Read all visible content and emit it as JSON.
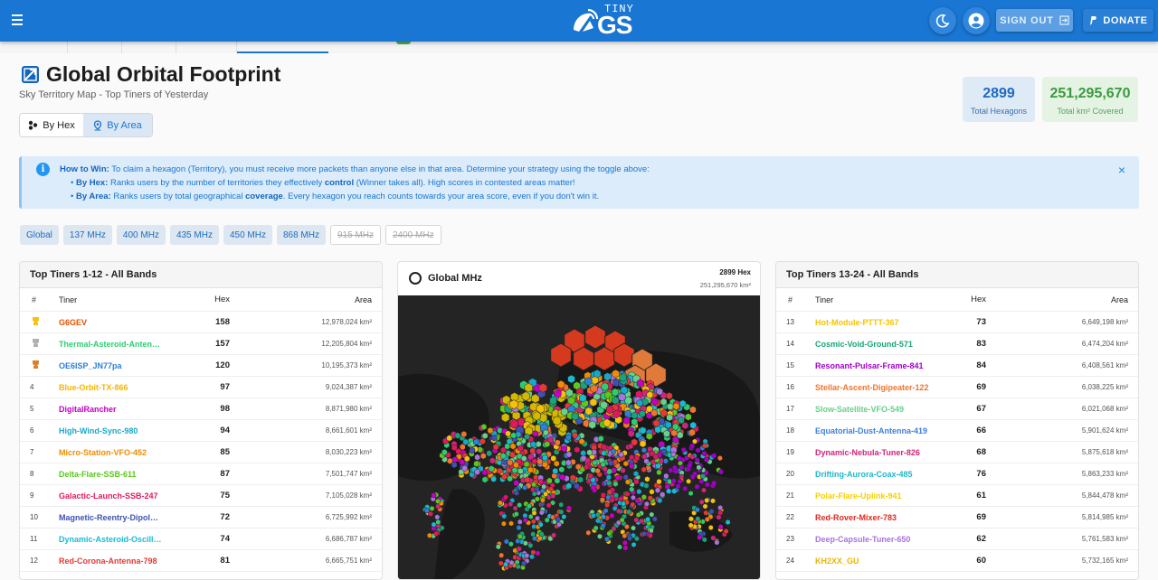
{
  "header": {
    "logo_top": "TINY",
    "logo_main": "GS",
    "signout_label": "SIGN OUT",
    "donate_label": "DONATE"
  },
  "page": {
    "title": "Global Orbital Footprint",
    "subtitle": "Sky Territory Map - Top Tiners of Yesterday"
  },
  "toggle": {
    "hex_label": "By Hex",
    "area_label": "By Area",
    "selected": "By Area"
  },
  "stats": {
    "hex_value": "2899",
    "hex_label": "Total Hexagons",
    "area_value": "251,295,670",
    "area_label": "Total km² Covered"
  },
  "alert": {
    "lead": "How to Win:",
    "line1": "To claim a hexagon (Territory), you must receive more packets than anyone else in that area. Determine your strategy using the toggle above:",
    "hex_lead": "By Hex:",
    "hex_text_a": "Ranks users by the number of territories they effectively",
    "hex_bold": "control",
    "hex_text_b": "(Winner takes all). High scores in contested areas matter!",
    "area_lead": "By Area:",
    "area_text_a": "Ranks users by total geographical",
    "area_bold": "coverage",
    "area_text_b": ". Every hexagon you reach counts towards your area score, even if you don't win it.",
    "close": "×"
  },
  "bands": [
    {
      "label": "Global",
      "disabled": false
    },
    {
      "label": "137 MHz",
      "disabled": false
    },
    {
      "label": "400 MHz",
      "disabled": false
    },
    {
      "label": "435 MHz",
      "disabled": false
    },
    {
      "label": "450 MHz",
      "disabled": false
    },
    {
      "label": "868 MHz",
      "disabled": false
    },
    {
      "label": "915 MHz",
      "disabled": true
    },
    {
      "label": "2400 MHz",
      "disabled": true
    }
  ],
  "table_columns": {
    "rank": "#",
    "name": "Tiner",
    "hex": "Hex",
    "area": "Area"
  },
  "left_table": {
    "title": "Top Tiners 1-12 - All Bands",
    "rows": [
      {
        "rank": "",
        "trophy": "#f4c20d",
        "name": "G6GEV",
        "color": "#e65100",
        "hex": "158",
        "area": "12,978,024 km²"
      },
      {
        "rank": "",
        "trophy": "#b0b0b0",
        "name": "Thermal-Asteroid-Anten…",
        "color": "#2ecc71",
        "hex": "157",
        "area": "12,205,804 km²"
      },
      {
        "rank": "",
        "trophy": "#d9822b",
        "name": "OE6ISP_JN77pa",
        "color": "#2f7ed8",
        "hex": "120",
        "area": "10,195,373 km²"
      },
      {
        "rank": "4",
        "trophy": "",
        "name": "Blue-Orbit-TX-866",
        "color": "#f2b600",
        "hex": "97",
        "area": "9,024,387 km²"
      },
      {
        "rank": "5",
        "trophy": "",
        "name": "DigitalRancher",
        "color": "#c400c4",
        "hex": "98",
        "area": "8,871,980 km²"
      },
      {
        "rank": "6",
        "trophy": "",
        "name": "High-Wind-Sync-980",
        "color": "#17a9c9",
        "hex": "94",
        "area": "8,661,601 km²"
      },
      {
        "rank": "7",
        "trophy": "",
        "name": "Micro-Station-VFO-452",
        "color": "#f08c00",
        "hex": "85",
        "area": "8,030,223 km²"
      },
      {
        "rank": "8",
        "trophy": "",
        "name": "Delta-Flare-SSB-611",
        "color": "#5cc71f",
        "hex": "87",
        "area": "7,501,747 km²"
      },
      {
        "rank": "9",
        "trophy": "",
        "name": "Galactic-Launch-SSB-247",
        "color": "#e0185f",
        "hex": "75",
        "area": "7,105,028 km²"
      },
      {
        "rank": "10",
        "trophy": "",
        "name": "Magnetic-Reentry-Dipol…",
        "color": "#3f51b5",
        "hex": "72",
        "area": "6,725,992 km²"
      },
      {
        "rank": "11",
        "trophy": "",
        "name": "Dynamic-Asteroid-Oscill…",
        "color": "#17bcd4",
        "hex": "74",
        "area": "6,686,787 km²"
      },
      {
        "rank": "12",
        "trophy": "",
        "name": "Red-Corona-Antenna-798",
        "color": "#e53935",
        "hex": "81",
        "area": "6,665,751 km²"
      }
    ]
  },
  "right_table": {
    "title": "Top Tiners 13-24 - All Bands",
    "rows": [
      {
        "rank": "13",
        "name": "Hot-Module-PTTT-367",
        "color": "#f5c400",
        "hex": "73",
        "area": "6,649,198 km²"
      },
      {
        "rank": "14",
        "name": "Cosmic-Void-Ground-571",
        "color": "#1aa37a",
        "hex": "83",
        "area": "6,474,204 km²"
      },
      {
        "rank": "15",
        "name": "Resonant-Pulsar-Frame-841",
        "color": "#a000c8",
        "hex": "84",
        "area": "6,408,561 km²"
      },
      {
        "rank": "16",
        "name": "Stellar-Ascent-Digipeater-122",
        "color": "#f0742c",
        "hex": "69",
        "area": "6,038,225 km²"
      },
      {
        "rank": "17",
        "name": "Slow-Satellite-VFO-549",
        "color": "#66d18a",
        "hex": "67",
        "area": "6,021,068 km²"
      },
      {
        "rank": "18",
        "name": "Equatorial-Dust-Antenna-419",
        "color": "#3d7fd9",
        "hex": "66",
        "area": "5,901,624 km²"
      },
      {
        "rank": "19",
        "name": "Dynamic-Nebula-Tuner-826",
        "color": "#d1247a",
        "hex": "68",
        "area": "5,875,618 km²"
      },
      {
        "rank": "20",
        "name": "Drifting-Aurora-Coax-485",
        "color": "#20b8c8",
        "hex": "76",
        "area": "5,863,233 km²"
      },
      {
        "rank": "21",
        "name": "Polar-Flare-Uplink-941",
        "color": "#f5d000",
        "hex": "61",
        "area": "5,844,478 km²"
      },
      {
        "rank": "22",
        "name": "Red-Rover-Mixer-783",
        "color": "#e0281e",
        "hex": "69",
        "area": "5,814,985 km²"
      },
      {
        "rank": "23",
        "name": "Deep-Capsule-Tuner-650",
        "color": "#a774e0",
        "hex": "62",
        "area": "5,761,583 km²"
      },
      {
        "rank": "24",
        "name": "KH2XX_GU",
        "color": "#e6b800",
        "hex": "60",
        "area": "5,732,165 km²"
      }
    ]
  },
  "map": {
    "title": "Global MHz",
    "hex_count": "2899 Hex",
    "area": "251,295,670 km²"
  },
  "colors": {
    "primary": "#1976d2",
    "map_background": "#242424"
  }
}
